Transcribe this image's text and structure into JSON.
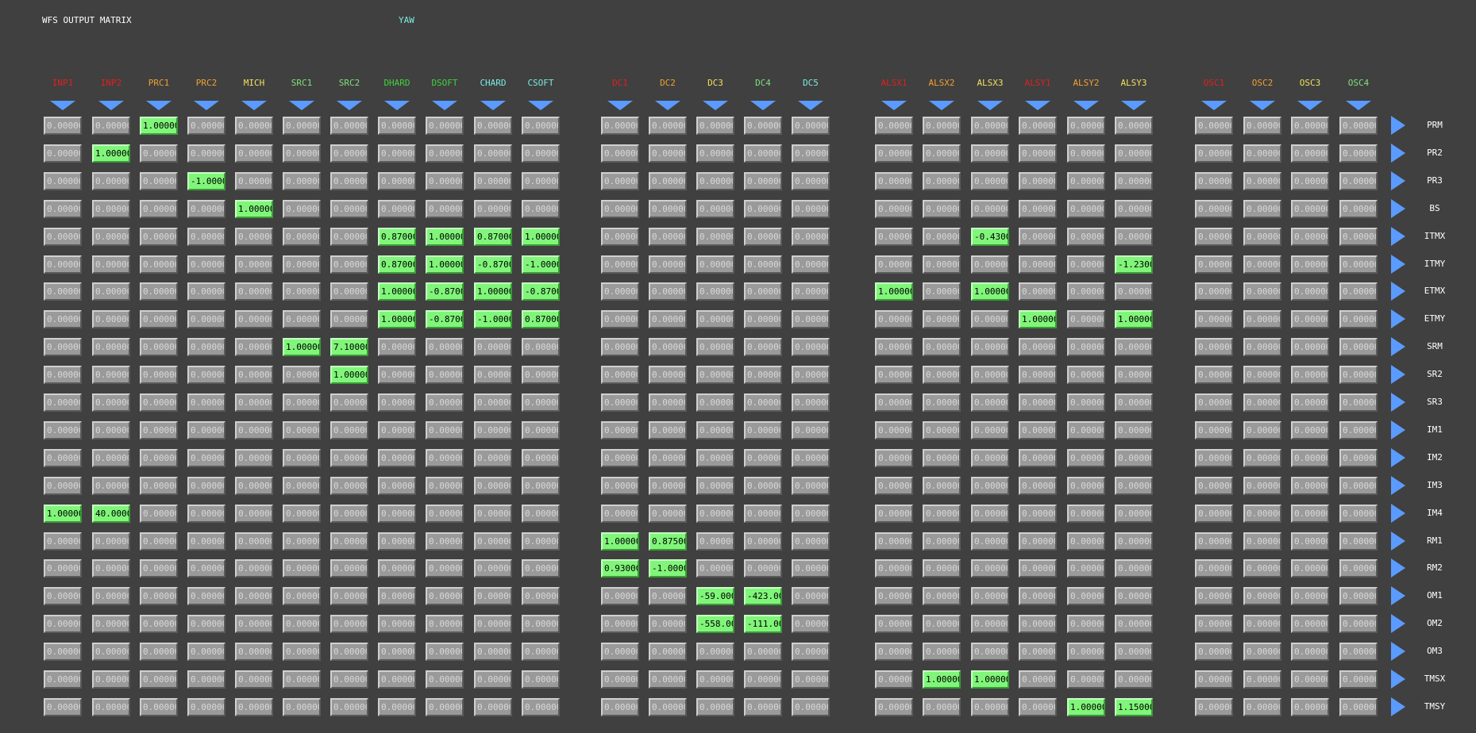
{
  "title": "WFS OUTPUT MATRIX",
  "subtitle": "YAW",
  "colors": {
    "background": "#404040",
    "cell_off": "#9a9a9a",
    "cell_on": "#80f57a",
    "arrow": "#5b9bff"
  },
  "columns": [
    {
      "label": "INP1",
      "color": "#e0201f"
    },
    {
      "label": "INP2",
      "color": "#e0201f"
    },
    {
      "label": "PRC1",
      "color": "#f0a030"
    },
    {
      "label": "PRC2",
      "color": "#f0a030"
    },
    {
      "label": "MICH",
      "color": "#f0e060"
    },
    {
      "label": "SRC1",
      "color": "#7fe07a"
    },
    {
      "label": "SRC2",
      "color": "#7fe07a"
    },
    {
      "label": "DHARD",
      "color": "#40d040"
    },
    {
      "label": "DSOFT",
      "color": "#40d040"
    },
    {
      "label": "CHARD",
      "color": "#7ce9e0"
    },
    {
      "label": "CSOFT",
      "color": "#7ce9e0"
    },
    {
      "label": "DC1",
      "color": "#e0201f"
    },
    {
      "label": "DC2",
      "color": "#f0a030"
    },
    {
      "label": "DC3",
      "color": "#f0e060"
    },
    {
      "label": "DC4",
      "color": "#7fe07a"
    },
    {
      "label": "DC5",
      "color": "#7ce9e0"
    },
    {
      "label": "ALSX1",
      "color": "#e0201f"
    },
    {
      "label": "ALSX2",
      "color": "#f0a030"
    },
    {
      "label": "ALSX3",
      "color": "#f0e060"
    },
    {
      "label": "ALSY1",
      "color": "#e0201f"
    },
    {
      "label": "ALSY2",
      "color": "#f0a030"
    },
    {
      "label": "ALSY3",
      "color": "#f0e060"
    },
    {
      "label": "OSC1",
      "color": "#e0201f"
    },
    {
      "label": "OSC2",
      "color": "#f0a030"
    },
    {
      "label": "OSC3",
      "color": "#f0e060"
    },
    {
      "label": "OSC4",
      "color": "#7fe07a"
    }
  ],
  "rows": [
    "PRM",
    "PR2",
    "PR3",
    "BS",
    "ITMX",
    "ITMY",
    "ETMX",
    "ETMY",
    "SRM",
    "SR2",
    "SR3",
    "IM1",
    "IM2",
    "IM3",
    "IM4",
    "RM1",
    "RM2",
    "OM1",
    "OM2",
    "OM3",
    "TMSX",
    "TMSY"
  ],
  "default_value": "0.00000",
  "matrix_values": [
    [
      "0.00000",
      "0.00000",
      "1.00000",
      "0.00000",
      "0.00000",
      "0.00000",
      "0.00000",
      "0.00000",
      "0.00000",
      "0.00000",
      "0.00000",
      "0.00000",
      "0.00000",
      "0.00000",
      "0.00000",
      "0.00000",
      "0.00000",
      "0.00000",
      "0.00000",
      "0.00000",
      "0.00000",
      "0.00000",
      "0.00000",
      "0.00000",
      "0.00000",
      "0.00000"
    ],
    [
      "0.00000",
      "1.00000",
      "0.00000",
      "0.00000",
      "0.00000",
      "0.00000",
      "0.00000",
      "0.00000",
      "0.00000",
      "0.00000",
      "0.00000",
      "0.00000",
      "0.00000",
      "0.00000",
      "0.00000",
      "0.00000",
      "0.00000",
      "0.00000",
      "0.00000",
      "0.00000",
      "0.00000",
      "0.00000",
      "0.00000",
      "0.00000",
      "0.00000",
      "0.00000"
    ],
    [
      "0.00000",
      "0.00000",
      "0.00000",
      "-1.0000",
      "0.00000",
      "0.00000",
      "0.00000",
      "0.00000",
      "0.00000",
      "0.00000",
      "0.00000",
      "0.00000",
      "0.00000",
      "0.00000",
      "0.00000",
      "0.00000",
      "0.00000",
      "0.00000",
      "0.00000",
      "0.00000",
      "0.00000",
      "0.00000",
      "0.00000",
      "0.00000",
      "0.00000",
      "0.00000"
    ],
    [
      "0.00000",
      "0.00000",
      "0.00000",
      "0.00000",
      "1.00000",
      "0.00000",
      "0.00000",
      "0.00000",
      "0.00000",
      "0.00000",
      "0.00000",
      "0.00000",
      "0.00000",
      "0.00000",
      "0.00000",
      "0.00000",
      "0.00000",
      "0.00000",
      "0.00000",
      "0.00000",
      "0.00000",
      "0.00000",
      "0.00000",
      "0.00000",
      "0.00000",
      "0.00000"
    ],
    [
      "0.00000",
      "0.00000",
      "0.00000",
      "0.00000",
      "0.00000",
      "0.00000",
      "0.00000",
      "0.87000",
      "1.00000",
      "0.87000",
      "1.00000",
      "0.00000",
      "0.00000",
      "0.00000",
      "0.00000",
      "0.00000",
      "0.00000",
      "0.00000",
      "-0.4300",
      "0.00000",
      "0.00000",
      "0.00000",
      "0.00000",
      "0.00000",
      "0.00000",
      "0.00000"
    ],
    [
      "0.00000",
      "0.00000",
      "0.00000",
      "0.00000",
      "0.00000",
      "0.00000",
      "0.00000",
      "0.87000",
      "1.00000",
      "-0.8700",
      "-1.0000",
      "0.00000",
      "0.00000",
      "0.00000",
      "0.00000",
      "0.00000",
      "0.00000",
      "0.00000",
      "0.00000",
      "0.00000",
      "0.00000",
      "-1.2300",
      "0.00000",
      "0.00000",
      "0.00000",
      "0.00000"
    ],
    [
      "0.00000",
      "0.00000",
      "0.00000",
      "0.00000",
      "0.00000",
      "0.00000",
      "0.00000",
      "1.00000",
      "-0.8700",
      "1.00000",
      "-0.8700",
      "0.00000",
      "0.00000",
      "0.00000",
      "0.00000",
      "0.00000",
      "1.00000",
      "0.00000",
      "1.00000",
      "0.00000",
      "0.00000",
      "0.00000",
      "0.00000",
      "0.00000",
      "0.00000",
      "0.00000"
    ],
    [
      "0.00000",
      "0.00000",
      "0.00000",
      "0.00000",
      "0.00000",
      "0.00000",
      "0.00000",
      "1.00000",
      "-0.8700",
      "-1.0000",
      "0.87000",
      "0.00000",
      "0.00000",
      "0.00000",
      "0.00000",
      "0.00000",
      "0.00000",
      "0.00000",
      "0.00000",
      "1.00000",
      "0.00000",
      "1.00000",
      "0.00000",
      "0.00000",
      "0.00000",
      "0.00000"
    ],
    [
      "0.00000",
      "0.00000",
      "0.00000",
      "0.00000",
      "0.00000",
      "1.00000",
      "7.10000",
      "0.00000",
      "0.00000",
      "0.00000",
      "0.00000",
      "0.00000",
      "0.00000",
      "0.00000",
      "0.00000",
      "0.00000",
      "0.00000",
      "0.00000",
      "0.00000",
      "0.00000",
      "0.00000",
      "0.00000",
      "0.00000",
      "0.00000",
      "0.00000",
      "0.00000"
    ],
    [
      "0.00000",
      "0.00000",
      "0.00000",
      "0.00000",
      "0.00000",
      "0.00000",
      "1.00000",
      "0.00000",
      "0.00000",
      "0.00000",
      "0.00000",
      "0.00000",
      "0.00000",
      "0.00000",
      "0.00000",
      "0.00000",
      "0.00000",
      "0.00000",
      "0.00000",
      "0.00000",
      "0.00000",
      "0.00000",
      "0.00000",
      "0.00000",
      "0.00000",
      "0.00000"
    ],
    [
      "0.00000",
      "0.00000",
      "0.00000",
      "0.00000",
      "0.00000",
      "0.00000",
      "0.00000",
      "0.00000",
      "0.00000",
      "0.00000",
      "0.00000",
      "0.00000",
      "0.00000",
      "0.00000",
      "0.00000",
      "0.00000",
      "0.00000",
      "0.00000",
      "0.00000",
      "0.00000",
      "0.00000",
      "0.00000",
      "0.00000",
      "0.00000",
      "0.00000",
      "0.00000"
    ],
    [
      "0.00000",
      "0.00000",
      "0.00000",
      "0.00000",
      "0.00000",
      "0.00000",
      "0.00000",
      "0.00000",
      "0.00000",
      "0.00000",
      "0.00000",
      "0.00000",
      "0.00000",
      "0.00000",
      "0.00000",
      "0.00000",
      "0.00000",
      "0.00000",
      "0.00000",
      "0.00000",
      "0.00000",
      "0.00000",
      "0.00000",
      "0.00000",
      "0.00000",
      "0.00000"
    ],
    [
      "0.00000",
      "0.00000",
      "0.00000",
      "0.00000",
      "0.00000",
      "0.00000",
      "0.00000",
      "0.00000",
      "0.00000",
      "0.00000",
      "0.00000",
      "0.00000",
      "0.00000",
      "0.00000",
      "0.00000",
      "0.00000",
      "0.00000",
      "0.00000",
      "0.00000",
      "0.00000",
      "0.00000",
      "0.00000",
      "0.00000",
      "0.00000",
      "0.00000",
      "0.00000"
    ],
    [
      "0.00000",
      "0.00000",
      "0.00000",
      "0.00000",
      "0.00000",
      "0.00000",
      "0.00000",
      "0.00000",
      "0.00000",
      "0.00000",
      "0.00000",
      "0.00000",
      "0.00000",
      "0.00000",
      "0.00000",
      "0.00000",
      "0.00000",
      "0.00000",
      "0.00000",
      "0.00000",
      "0.00000",
      "0.00000",
      "0.00000",
      "0.00000",
      "0.00000",
      "0.00000"
    ],
    [
      "1.00000",
      "40.0000",
      "0.00000",
      "0.00000",
      "0.00000",
      "0.00000",
      "0.00000",
      "0.00000",
      "0.00000",
      "0.00000",
      "0.00000",
      "0.00000",
      "0.00000",
      "0.00000",
      "0.00000",
      "0.00000",
      "0.00000",
      "0.00000",
      "0.00000",
      "0.00000",
      "0.00000",
      "0.00000",
      "0.00000",
      "0.00000",
      "0.00000",
      "0.00000"
    ],
    [
      "0.00000",
      "0.00000",
      "0.00000",
      "0.00000",
      "0.00000",
      "0.00000",
      "0.00000",
      "0.00000",
      "0.00000",
      "0.00000",
      "0.00000",
      "1.00000",
      "0.87500",
      "0.00000",
      "0.00000",
      "0.00000",
      "0.00000",
      "0.00000",
      "0.00000",
      "0.00000",
      "0.00000",
      "0.00000",
      "0.00000",
      "0.00000",
      "0.00000",
      "0.00000"
    ],
    [
      "0.00000",
      "0.00000",
      "0.00000",
      "0.00000",
      "0.00000",
      "0.00000",
      "0.00000",
      "0.00000",
      "0.00000",
      "0.00000",
      "0.00000",
      "0.93000",
      "-1.0000",
      "0.00000",
      "0.00000",
      "0.00000",
      "0.00000",
      "0.00000",
      "0.00000",
      "0.00000",
      "0.00000",
      "0.00000",
      "0.00000",
      "0.00000",
      "0.00000",
      "0.00000"
    ],
    [
      "0.00000",
      "0.00000",
      "0.00000",
      "0.00000",
      "0.00000",
      "0.00000",
      "0.00000",
      "0.00000",
      "0.00000",
      "0.00000",
      "0.00000",
      "0.00000",
      "0.00000",
      "-59.000",
      "-423.00",
      "0.00000",
      "0.00000",
      "0.00000",
      "0.00000",
      "0.00000",
      "0.00000",
      "0.00000",
      "0.00000",
      "0.00000",
      "0.00000",
      "0.00000"
    ],
    [
      "0.00000",
      "0.00000",
      "0.00000",
      "0.00000",
      "0.00000",
      "0.00000",
      "0.00000",
      "0.00000",
      "0.00000",
      "0.00000",
      "0.00000",
      "0.00000",
      "0.00000",
      "-558.00",
      "-111.00",
      "0.00000",
      "0.00000",
      "0.00000",
      "0.00000",
      "0.00000",
      "0.00000",
      "0.00000",
      "0.00000",
      "0.00000",
      "0.00000",
      "0.00000"
    ],
    [
      "0.00000",
      "0.00000",
      "0.00000",
      "0.00000",
      "0.00000",
      "0.00000",
      "0.00000",
      "0.00000",
      "0.00000",
      "0.00000",
      "0.00000",
      "0.00000",
      "0.00000",
      "0.00000",
      "0.00000",
      "0.00000",
      "0.00000",
      "0.00000",
      "0.00000",
      "0.00000",
      "0.00000",
      "0.00000",
      "0.00000",
      "0.00000",
      "0.00000",
      "0.00000"
    ],
    [
      "0.00000",
      "0.00000",
      "0.00000",
      "0.00000",
      "0.00000",
      "0.00000",
      "0.00000",
      "0.00000",
      "0.00000",
      "0.00000",
      "0.00000",
      "0.00000",
      "0.00000",
      "0.00000",
      "0.00000",
      "0.00000",
      "0.00000",
      "1.00000",
      "1.00000",
      "0.00000",
      "0.00000",
      "0.00000",
      "0.00000",
      "0.00000",
      "0.00000",
      "0.00000"
    ],
    [
      "0.00000",
      "0.00000",
      "0.00000",
      "0.00000",
      "0.00000",
      "0.00000",
      "0.00000",
      "0.00000",
      "0.00000",
      "0.00000",
      "0.00000",
      "0.00000",
      "0.00000",
      "0.00000",
      "0.00000",
      "0.00000",
      "0.00000",
      "0.00000",
      "0.00000",
      "0.00000",
      "1.00000",
      "1.15000",
      "0.00000",
      "0.00000",
      "0.00000",
      "0.00000"
    ]
  ]
}
